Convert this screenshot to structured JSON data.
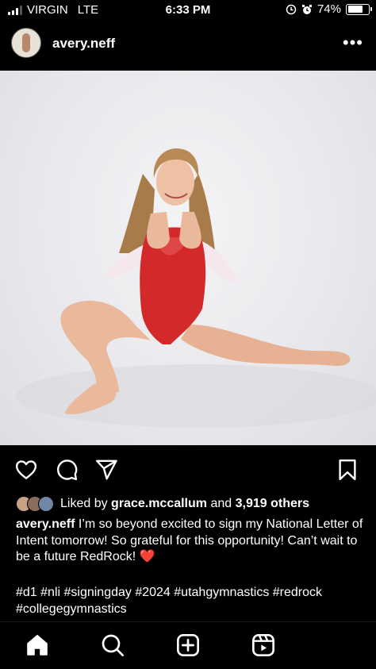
{
  "status_bar": {
    "carrier": "VIRGIN",
    "network": "LTE",
    "time": "6:33 PM",
    "battery": "74%",
    "battery_level": 0.74
  },
  "post": {
    "username": "avery.neff",
    "likes": {
      "prefix": "Liked by",
      "user": "grace.mccallum",
      "connector": "and",
      "others": "3,919 others"
    },
    "caption": {
      "username": "avery.neff",
      "text": "I’m so beyond excited to sign my National Letter of Intent tomorrow! So grateful for this opportunity! Can’t wait to be a future RedRock!",
      "emoji": "❤️"
    },
    "hashtags": "#d1 #nli #signingday #2024 #utahgymnastics #redrock #collegegymnastics"
  },
  "icons": {
    "like": "heart-icon",
    "comment": "comment-icon",
    "share": "send-icon",
    "save": "bookmark-icon",
    "more": "more-icon"
  },
  "nav": [
    "home-icon",
    "search-icon",
    "create-icon",
    "reels-icon"
  ],
  "colors": {
    "background": "#000000",
    "text": "#ffffff",
    "heart": "#e0262a",
    "leotard": "#d3292b"
  }
}
